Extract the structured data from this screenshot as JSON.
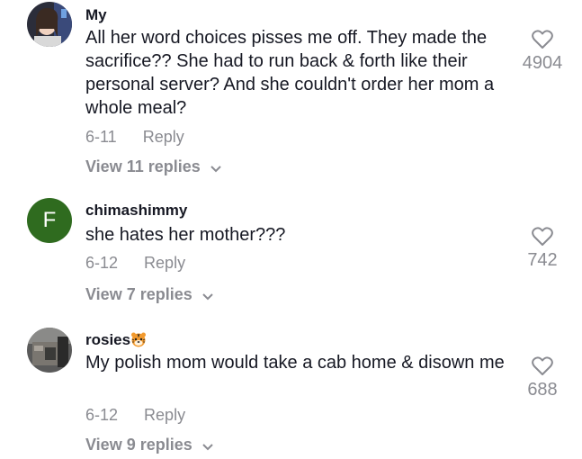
{
  "comments": [
    {
      "username": "My",
      "text": "All her word choices pisses me off. They made the sacrifice?? She had to run back & forth like their personal server? And she couldn't order her mom a whole meal?",
      "date": "6-11",
      "reply_label": "Reply",
      "like_count": "4904",
      "view_replies": "View 11 replies",
      "avatar": "photo"
    },
    {
      "username": "chimashimmy",
      "text": "she hates her mother???",
      "date": "6-12",
      "reply_label": "Reply",
      "like_count": "742",
      "view_replies": "View 7 replies",
      "avatar_letter": "F",
      "avatar_color": "#2f6b1f"
    },
    {
      "username": "rosies",
      "username_emoji": "tiger-face-emoji",
      "text": "My polish mom would take a cab home & disown me",
      "date": "6-12",
      "reply_label": "Reply",
      "like_count": "688",
      "view_replies": "View 9 replies",
      "avatar": "photo"
    }
  ],
  "colors": {
    "text": "#161823",
    "secondary": "#8a8b91"
  },
  "icons": {
    "like": "heart-outline-icon",
    "expand": "chevron-down-icon"
  }
}
